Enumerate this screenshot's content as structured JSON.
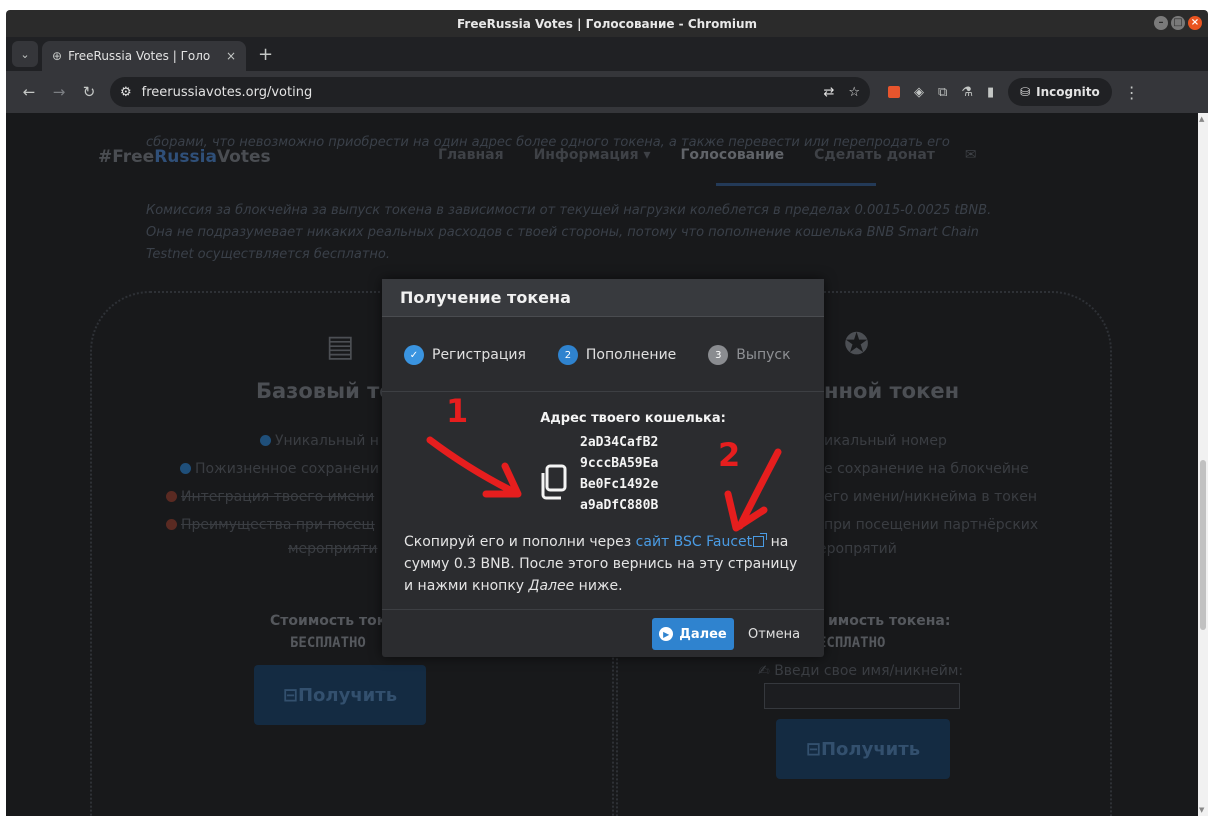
{
  "window": {
    "title": "FreeRussia Votes | Голосование - Chromium"
  },
  "tab": {
    "title": "FreeRussia Votes | Голо",
    "close": "×",
    "new": "+"
  },
  "toolbar": {
    "url": "freerussiavotes.org/voting",
    "incognito_label": "Incognito"
  },
  "site": {
    "brand_prefix": "#Free",
    "brand_mid": "Russia",
    "brand_suffix": "Votes",
    "nav": [
      {
        "label": "Главная"
      },
      {
        "label": "Информация ▾"
      },
      {
        "label": "Голосование"
      },
      {
        "label": "Сделать донат"
      }
    ],
    "top_text_1": "сборами, что невозможно приобрести на один адрес более одного токена, а также перевести или перепродать его",
    "fee_text_1": "Комиссия за блокчейна за выпуск токена в зависимости от текущей нагрузки колеблется в пределах 0.0015-0.0025 tBNB.",
    "fee_text_2": "Она не подразумевает никаких реальных расходов с твоей стороны, потому что пополнение кошелька BNB Smart Chain",
    "fee_text_3": "Testnet осуществляется бесплатно."
  },
  "left_card": {
    "heading": "Базовый то",
    "features": [
      "Уникальный н",
      "Пожизненное сохранени",
      "Интеграция твоего имени",
      "Преимущества при посещ",
      "мероприяти"
    ],
    "cost_label": "Стоимость ток",
    "cost_value": "БЕСПЛАТНО",
    "button": "Получить"
  },
  "right_card": {
    "heading": "нной токен",
    "features": [
      "икальный номер",
      "е сохранение на блокчейне",
      "его имени/никнейма в токен",
      "при посещении партнёрских",
      "еропрятий"
    ],
    "cost_label": "имость токена:",
    "cost_value": "ЕСПЛАТНО",
    "name_label": "Введи свое имя/никнейм:",
    "button": "Получить"
  },
  "modal": {
    "title": "Получение токена",
    "steps": [
      {
        "label": "Регистрация",
        "marker": "✓",
        "state": "done"
      },
      {
        "label": "Пополнение",
        "marker": "2",
        "state": "current"
      },
      {
        "label": "Выпуск",
        "marker": "3",
        "state": "pending"
      }
    ],
    "wallet_title": "Адрес твоего кошелька:",
    "wallet_lines": [
      "2aD34CafB2",
      "9cccBA59Ea",
      "Be0Fc1492e",
      "a9aDfC880B"
    ],
    "text_before_link": "Скопируй его и пополни через ",
    "link_text": "сайт BSC Faucet",
    "text_after_link": " на сумму 0.3 BNB. После этого вернись на эту страницу и нажми кнопку ",
    "emphasis": "Далее",
    "text_end": " ниже.",
    "next_button": "Далее",
    "cancel_button": "Отмена"
  },
  "annotations": {
    "marker_1": "1",
    "marker_2": "2",
    "color": "#e61e1e"
  }
}
